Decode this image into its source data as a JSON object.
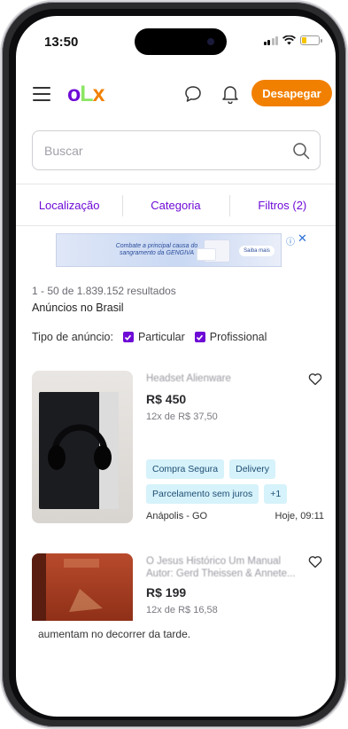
{
  "status": {
    "time": "13:50"
  },
  "header": {
    "logo": {
      "o": "o",
      "l": "L",
      "x": "x"
    },
    "cta_label": "Desapegar"
  },
  "search": {
    "placeholder": "Buscar"
  },
  "filters": {
    "location": "Localização",
    "category": "Categoria",
    "filters": "Filtros (2)"
  },
  "ad": {
    "text": "Combate a principal causa do sangramento da GENGIVA",
    "cta": "Saiba mais"
  },
  "results": {
    "count": "1 - 50 de 1.839.152 resultados",
    "region": "Anúncios no Brasil",
    "type_label": "Tipo de anúncio:",
    "type_private": "Particular",
    "type_professional": "Profissional"
  },
  "listings": [
    {
      "title": "Headset Alienware",
      "price": "R$ 450",
      "installments": "12x de R$ 37,50",
      "tags": [
        "Compra Segura",
        "Delivery",
        "Parcelamento sem juros",
        "+1"
      ],
      "location": "Anápolis - GO",
      "date": "Hoje, 09:11"
    },
    {
      "title": "O Jesus Histórico Um Manual Autor: Gerd Theissen & Annete...",
      "price": "R$ 199",
      "installments": "12x de R$ 16,58"
    }
  ],
  "toast": {
    "text": "aumentam no decorrer da tarde."
  },
  "colors": {
    "brand_purple": "#6e0ad6",
    "brand_orange": "#f28000",
    "brand_green": "#8ce563",
    "tag_bg": "#d6f2fb"
  }
}
